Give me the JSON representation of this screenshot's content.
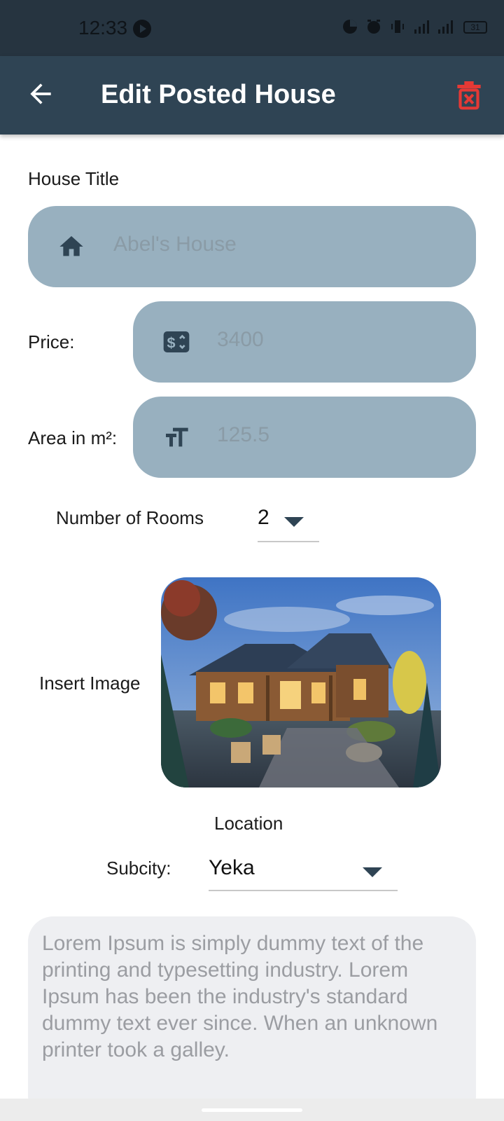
{
  "status_bar": {
    "time": "12:33",
    "battery": "31"
  },
  "app_bar": {
    "title": "Edit Posted House"
  },
  "form": {
    "house_title_label": "House Title",
    "house_title_value": "Abel's House",
    "price_label": "Price:",
    "price_value": "3400",
    "area_label": "Area in m²:",
    "area_value": "125.5",
    "rooms_label": "Number of Rooms",
    "rooms_value": "2",
    "image_label": "Insert Image",
    "location_label": "Location",
    "subcity_label": "Subcity:",
    "subcity_value": "Yeka",
    "description": "Lorem Ipsum is simply dummy text of the printing and typesetting industry. Lorem Ipsum has been the industry's standard dummy text ever since. When an unknown printer took a galley."
  },
  "colors": {
    "app_bar": "#2f4454",
    "status_bar": "#263440",
    "field_bg": "#98b0bf",
    "delete_icon": "#e53935",
    "description_bg": "#eeeff2"
  },
  "icons": {
    "back": "arrow-back-icon",
    "delete": "trash-icon",
    "title_field": "home-icon",
    "price_field": "dollar-icon",
    "area_field": "text-size-icon"
  }
}
